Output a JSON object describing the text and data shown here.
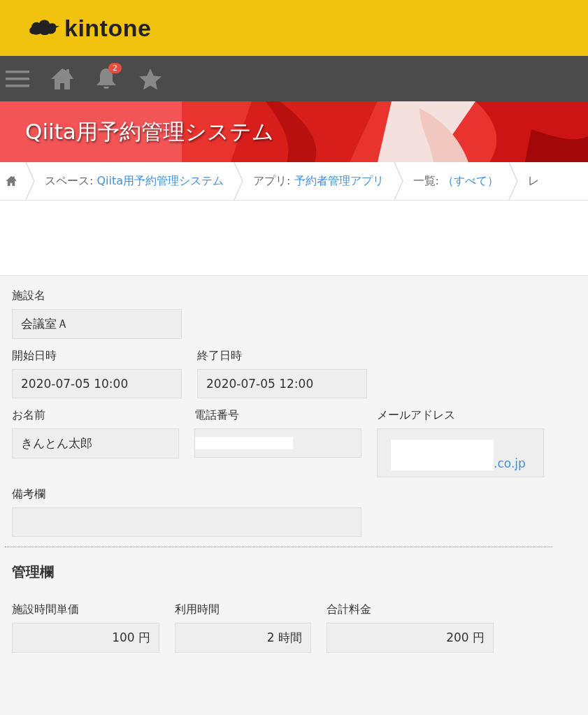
{
  "header": {
    "logo": "kintone"
  },
  "nav": {
    "notification_count": "2"
  },
  "banner": {
    "title": "Qiita用予約管理システム"
  },
  "breadcrumb": [
    {
      "label": "スペース: ",
      "link": "Qiita用予約管理システム"
    },
    {
      "label": "アプリ: ",
      "link": "予約者管理アプリ"
    },
    {
      "label": "一覧: ",
      "link": "（すべて）"
    },
    {
      "label": "レ"
    }
  ],
  "rows": [
    [
      {
        "label": "施設名",
        "value": "会議室Ａ",
        "kind": "text"
      }
    ],
    [
      {
        "label": "開始日時",
        "value": "2020-07-05 10:00",
        "kind": "text"
      },
      {
        "label": "終了日時",
        "value": "2020-07-05 12:00",
        "kind": "text"
      }
    ],
    [
      {
        "label": "お名前",
        "value": "きんとん太郎",
        "kind": "text"
      },
      {
        "label": "電話番号",
        "kind": "redacted"
      },
      {
        "label": "メールアドレス",
        "value": ".co.jp",
        "kind": "redacted_link"
      }
    ],
    [
      {
        "label": "備考欄",
        "kind": "empty"
      }
    ]
  ],
  "section": {
    "title": "管理欄",
    "rows": [
      [
        {
          "label": "施設時間単価",
          "value": "100 円",
          "kind": "number"
        },
        {
          "label": "利用時間",
          "value": "2 時間",
          "kind": "number"
        },
        {
          "label": "合計料金",
          "value": "200 円",
          "kind": "number"
        }
      ]
    ]
  }
}
